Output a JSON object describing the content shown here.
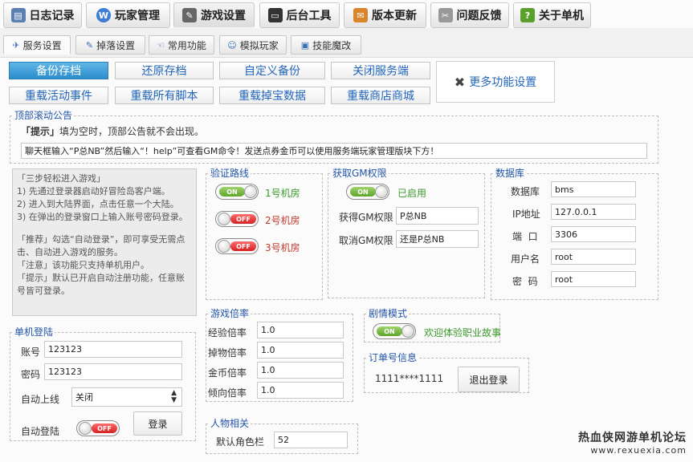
{
  "top_tabs": [
    {
      "label": "日志记录",
      "icon": "log-icon",
      "active": false
    },
    {
      "label": "玩家管理",
      "icon": "player-icon",
      "active": false
    },
    {
      "label": "游戏设置",
      "icon": "tools-icon",
      "active": true
    },
    {
      "label": "后台工具",
      "icon": "monitor-icon",
      "active": false
    },
    {
      "label": "版本更新",
      "icon": "update-icon",
      "active": false
    },
    {
      "label": "问题反馈",
      "icon": "feedback-icon",
      "active": false
    },
    {
      "label": "关于单机",
      "icon": "about-icon",
      "active": false
    }
  ],
  "sub_tabs": [
    {
      "label": "服务设置",
      "icon": "service-icon",
      "active": true
    },
    {
      "label": "掉落设置",
      "icon": "drop-icon",
      "active": false
    },
    {
      "label": "常用功能",
      "icon": "hand-icon",
      "active": false
    },
    {
      "label": "模拟玩家",
      "icon": "robot-icon",
      "active": false
    },
    {
      "label": "技能魔改",
      "icon": "skill-icon",
      "active": false
    }
  ],
  "actions": {
    "row1": [
      "备份存档",
      "还原存档",
      "自定义备份",
      "关闭服务端"
    ],
    "row2": [
      "重载活动事件",
      "重载所有脚本",
      "重载掉宝数据",
      "重载商店商城"
    ],
    "more": "更多功能设置"
  },
  "announcement": {
    "legend": "顶部滚动公告",
    "tip_bracket": "「提示」",
    "tip_text": "填为空时，顶部公告就不会出现。",
    "value": "聊天框输入“P总NB”然后输入“！help”可查看GM命令！发送点券金币可以使用服务端玩家管理版块下方！"
  },
  "guide": {
    "lines": [
      "「三步轻松进入游戏」",
      "1) 先通过登录器启动好冒险岛客户端。",
      "2) 进入到大陆界面，点击任意一个大陆。",
      "3) 在弹出的登录窗口上输入账号密码登录。",
      "",
      "「推荐」勾选“自动登录”，即可享受无需点击、自动进入游戏的服务。",
      "「注意」该功能只支持单机用户。",
      "「提示」默认已开启自动注册功能，任意账号皆可登录。"
    ]
  },
  "routes": {
    "legend": "验证路线",
    "items": [
      {
        "label": "1号机房",
        "state": "ON",
        "on": true,
        "color": "#3a9a2a"
      },
      {
        "label": "2号机房",
        "state": "OFF",
        "on": false,
        "color": "#c0392b"
      },
      {
        "label": "3号机房",
        "state": "OFF",
        "on": false,
        "color": "#c0392b"
      }
    ]
  },
  "gm": {
    "legend": "获取GM权限",
    "toggle_state": "ON",
    "status": "已启用",
    "get_label": "获得GM权限",
    "get_value": "P总NB",
    "cancel_label": "取消GM权限",
    "cancel_value": "还是P总NB"
  },
  "database": {
    "legend": "数据库",
    "fields": [
      {
        "label": "数据库",
        "value": "bms"
      },
      {
        "label": "IP地址",
        "value": "127.0.0.1"
      },
      {
        "label": "端  口",
        "value": "3306"
      },
      {
        "label": "用户名",
        "value": "root"
      },
      {
        "label": "密  码",
        "value": "root"
      }
    ]
  },
  "login": {
    "legend": "单机登陆",
    "account_label": "账号",
    "account_value": "123123",
    "password_label": "密码",
    "password_value": "123123",
    "auto_online_label": "自动上线",
    "auto_online_value": "关闭",
    "auto_login_label": "自动登陆",
    "auto_login_state": "OFF",
    "login_button": "登录"
  },
  "rates": {
    "legend": "游戏倍率",
    "items": [
      {
        "label": "经验倍率",
        "value": "1.0"
      },
      {
        "label": "掉物倍率",
        "value": "1.0"
      },
      {
        "label": "金币倍率",
        "value": "1.0"
      },
      {
        "label": "倾向倍率",
        "value": "1.0"
      }
    ]
  },
  "story": {
    "legend": "剧情模式",
    "toggle_state": "ON",
    "text": "欢迎体验职业故事"
  },
  "order": {
    "legend": "订单号信息",
    "number": "1111****1111",
    "logout_button": "退出登录"
  },
  "character": {
    "legend": "人物相关",
    "slot_label": "默认角色栏",
    "slot_value": "52"
  },
  "watermark": {
    "line1": "热血侠网游单机论坛",
    "line2": "www.rexuexia.com"
  },
  "colors": {
    "legend_blue": "#2255aa",
    "link_blue": "#2266bb",
    "on_green": "#3a9a2a",
    "off_red": "#c0392b"
  }
}
